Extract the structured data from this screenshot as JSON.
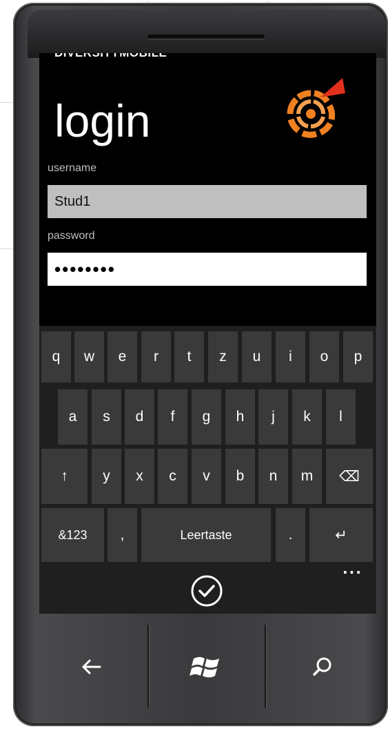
{
  "app": {
    "name": "DIVERSITYMOBILE",
    "page_title": "login"
  },
  "form": {
    "username_label": "username",
    "username_value": "Stud1",
    "password_label": "password",
    "password_value": "••••••••"
  },
  "keyboard": {
    "row1": [
      "q",
      "w",
      "e",
      "r",
      "t",
      "z",
      "u",
      "i",
      "o",
      "p"
    ],
    "row2": [
      "a",
      "s",
      "d",
      "f",
      "g",
      "h",
      "j",
      "k",
      "l"
    ],
    "row3": [
      "↑",
      "y",
      "x",
      "c",
      "v",
      "b",
      "n",
      "m",
      "⌫"
    ],
    "row4": [
      "&123",
      ",",
      "Leertaste",
      ".",
      "↵"
    ],
    "more": "..."
  },
  "hardware_buttons": {
    "back": "back-arrow",
    "start": "windows-logo",
    "search": "search"
  },
  "colors": {
    "screen_bg": "#000000",
    "key_bg": "#3a3a3a",
    "username_field_bg": "#bfbfbf",
    "password_field_bg": "#ffffff",
    "logo_orange": "#f08020",
    "logo_red": "#e0301c"
  }
}
